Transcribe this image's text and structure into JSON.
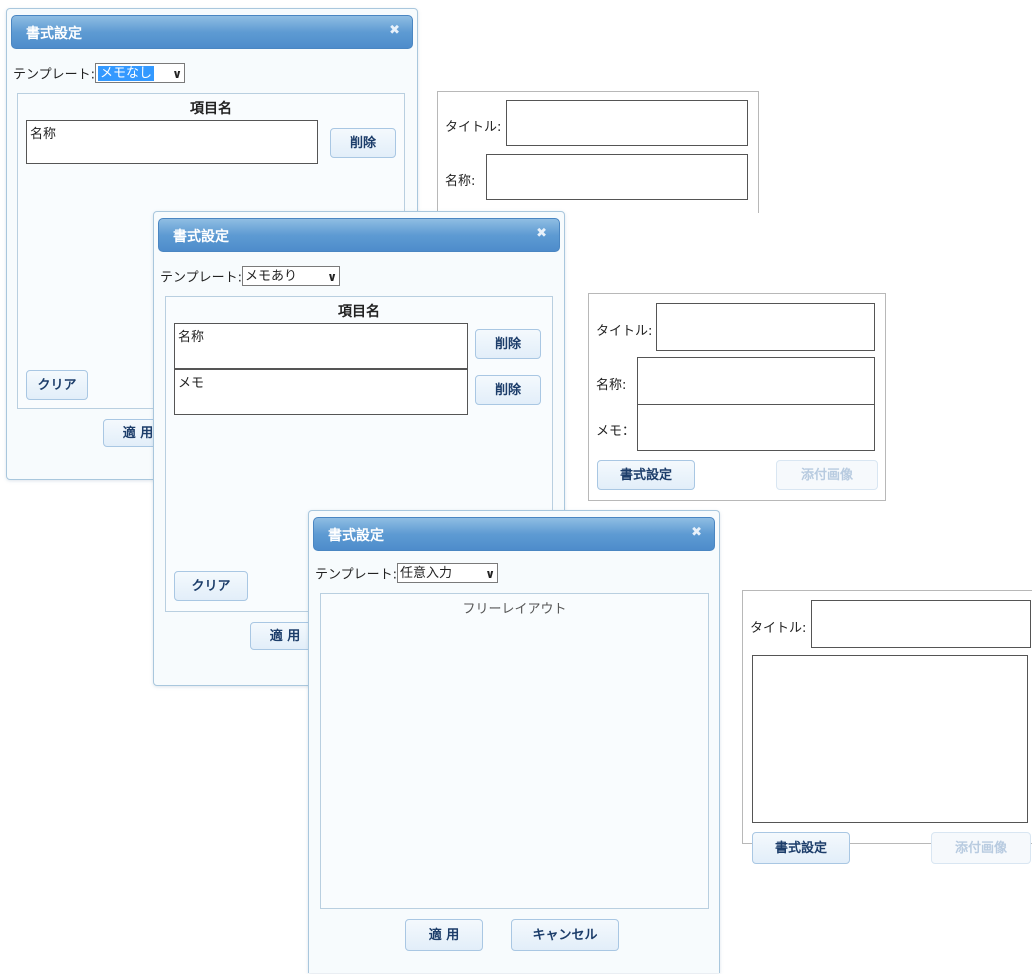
{
  "dialog1": {
    "title": "書式設定",
    "close_icon": "close-icon",
    "template_label": "テンプレート:",
    "template_value": "メモなし",
    "fields_header": "項目名",
    "fields": [
      {
        "name": "名称",
        "delete_label": "削除"
      }
    ],
    "clear_label": "クリア",
    "apply_label": "適 用"
  },
  "preview1": {
    "title_label": "タイトル:",
    "fields": [
      "名称:"
    ]
  },
  "dialog2": {
    "title": "書式設定",
    "close_icon": "close-icon",
    "template_label": "テンプレート:",
    "template_value": "メモあり",
    "fields_header": "項目名",
    "fields": [
      {
        "name": "名称",
        "delete_label": "削除"
      },
      {
        "name": "メモ",
        "delete_label": "削除"
      }
    ],
    "clear_label": "クリア",
    "apply_label": "適 用"
  },
  "preview2": {
    "title_label": "タイトル:",
    "fields": [
      "名称:",
      "メモ："
    ],
    "format_button": "書式設定",
    "attach_button": "添付画像"
  },
  "dialog3": {
    "title": "書式設定",
    "close_icon": "close-icon",
    "template_label": "テンプレート:",
    "template_value": "任意入力",
    "free_layout_label": "フリーレイアウト",
    "apply_label": "適 用",
    "cancel_label": "キャンセル"
  },
  "preview3": {
    "title_label": "タイトル:",
    "format_button": "書式設定",
    "attach_button": "添付画像"
  },
  "colors": {
    "titlebar": "#5e9bd3",
    "button_text": "#1c3d6a",
    "selection": "#3399ff"
  }
}
